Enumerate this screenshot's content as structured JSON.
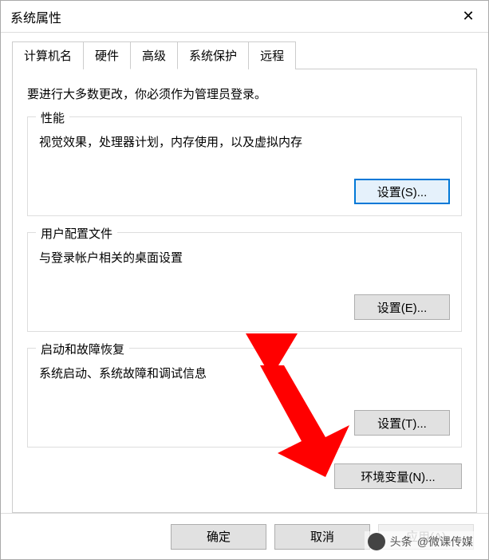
{
  "window": {
    "title": "系统属性"
  },
  "tabs": {
    "computer_name": "计算机名",
    "hardware": "硬件",
    "advanced": "高级",
    "system_protection": "系统保护",
    "remote": "远程"
  },
  "intro": "要进行大多数更改，你必须作为管理员登录。",
  "performance": {
    "legend": "性能",
    "desc": "视觉效果，处理器计划，内存使用，以及虚拟内存",
    "button": "设置(S)..."
  },
  "user_profiles": {
    "legend": "用户配置文件",
    "desc": "与登录帐户相关的桌面设置",
    "button": "设置(E)..."
  },
  "startup": {
    "legend": "启动和故障恢复",
    "desc": "系统启动、系统故障和调试信息",
    "button": "设置(T)..."
  },
  "env_button": "环境变量(N)...",
  "buttons": {
    "ok": "确定",
    "cancel": "取消",
    "apply": "应用(A)"
  },
  "watermark": {
    "source": "头条",
    "handle": "@微课传媒"
  },
  "colors": {
    "arrow": "#ff0000",
    "focus": "#0078d7"
  }
}
